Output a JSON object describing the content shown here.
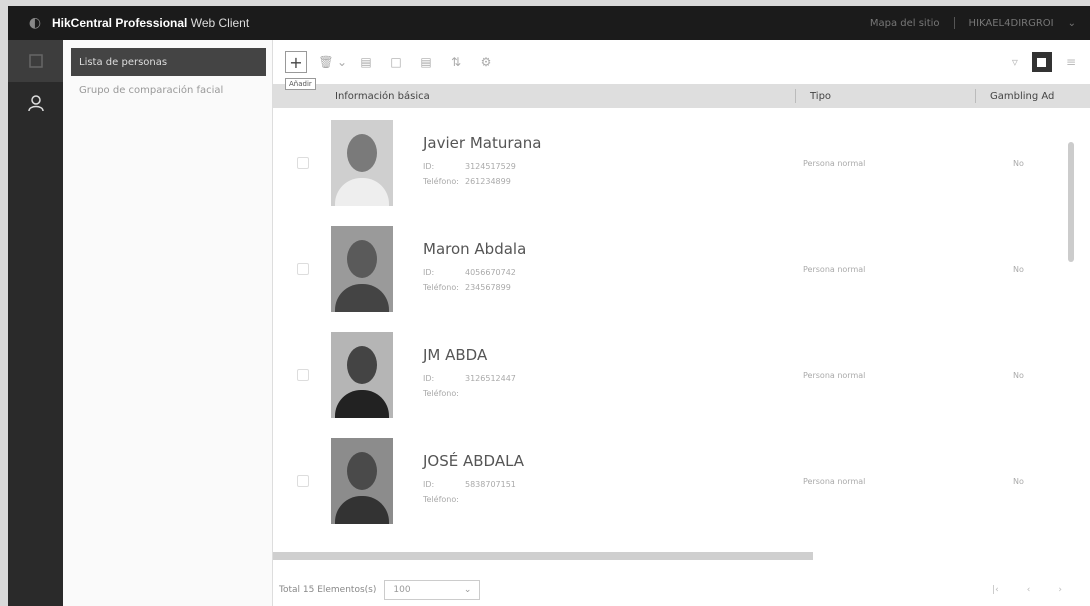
{
  "header": {
    "title_bold": "HikCentral Professional",
    "title_rest": " Web Client",
    "link1": "Mapa del sitio",
    "user": "HIKAEL4DIRGROI"
  },
  "sidebar": {
    "items": [
      {
        "label": "Lista de personas"
      },
      {
        "label": "Grupo de comparación facial"
      }
    ]
  },
  "toolbar": {
    "tooltip": "Añadir"
  },
  "table": {
    "columns": [
      "Información básica",
      "Tipo",
      "Gambling Ad"
    ],
    "id_label": "ID:",
    "phone_label": "Teléfono:",
    "rows": [
      {
        "name": "Javier Maturana",
        "id": "3124517529",
        "phone": "261234899",
        "type": "Persona normal",
        "gen": "No"
      },
      {
        "name": "Maron Abdala",
        "id": "4056670742",
        "phone": "234567899",
        "type": "Persona normal",
        "gen": "No"
      },
      {
        "name": "JM ABDA",
        "id": "3126512447",
        "phone": "",
        "type": "Persona normal",
        "gen": "No"
      },
      {
        "name": "JOSÉ ABDALA",
        "id": "5838707151",
        "phone": "",
        "type": "Persona normal",
        "gen": "No"
      }
    ]
  },
  "footer": {
    "total": "Total 15 Elementos(s)",
    "page_size": "100"
  }
}
